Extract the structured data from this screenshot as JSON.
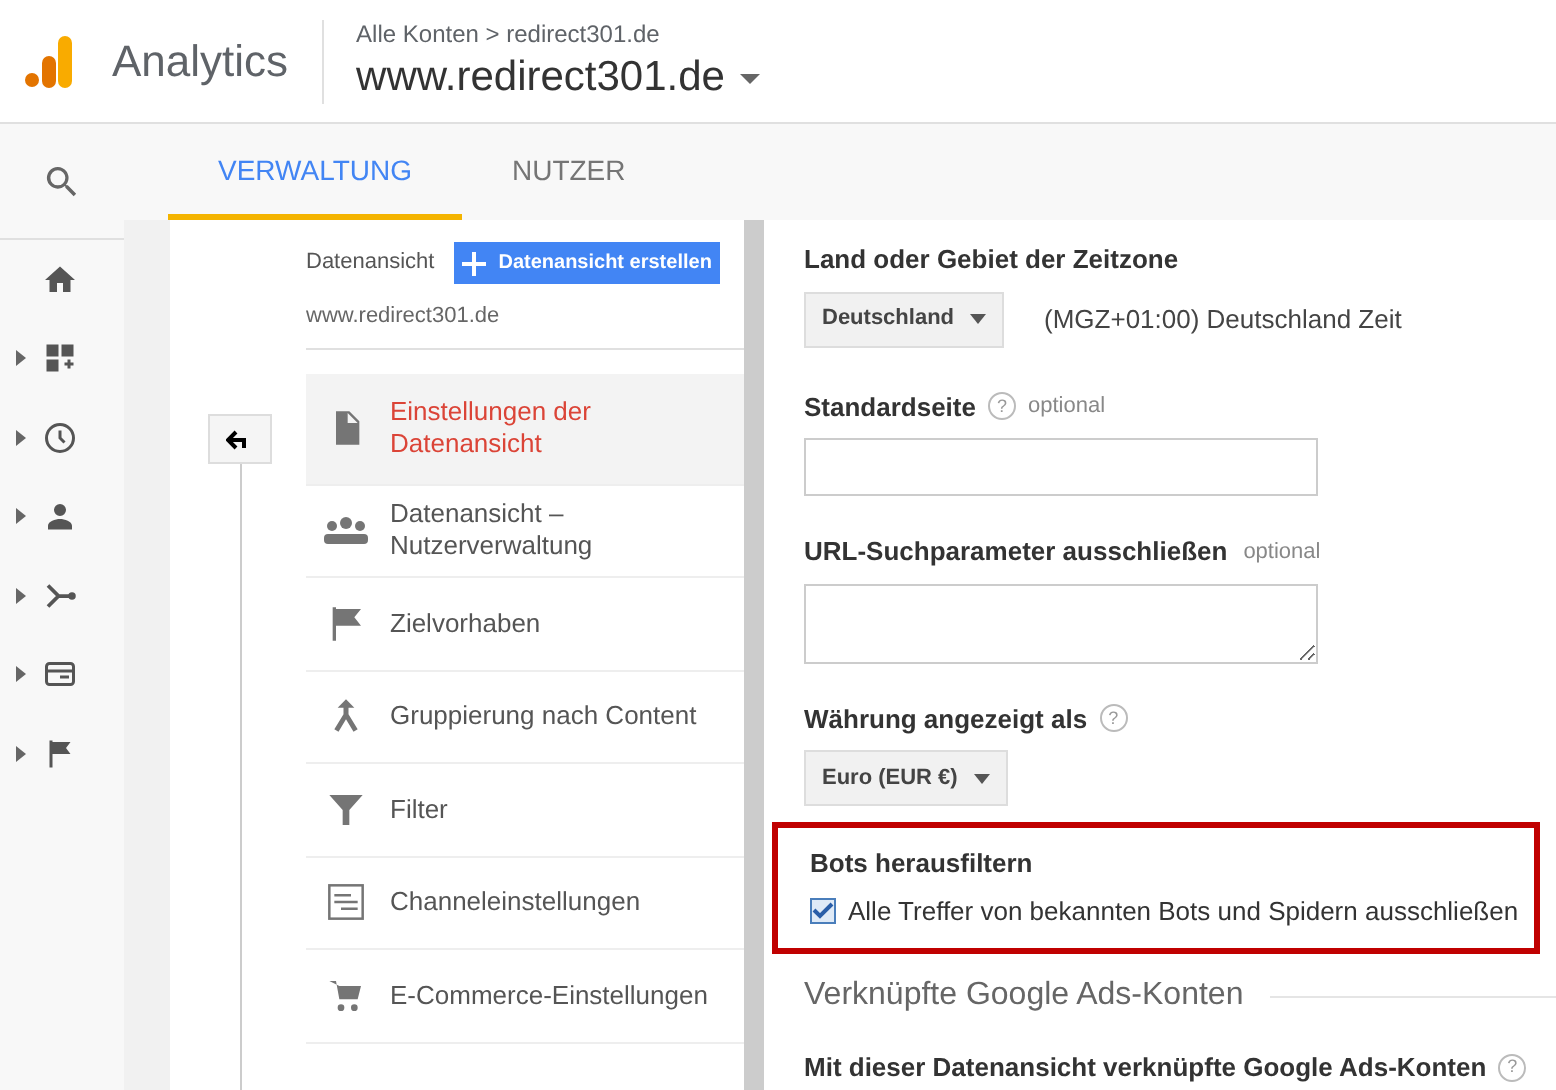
{
  "header": {
    "product": "Analytics",
    "breadcrumb": "Alle Konten > redirect301.de",
    "property": "www.redirect301.de"
  },
  "tabs": [
    {
      "label": "VERWALTUNG",
      "selected": true
    },
    {
      "label": "NUTZER",
      "selected": false
    }
  ],
  "sidebar": {
    "items": [
      {
        "expandable": false
      },
      {
        "expandable": true
      },
      {
        "expandable": true
      },
      {
        "expandable": true
      },
      {
        "expandable": true
      },
      {
        "expandable": true
      },
      {
        "expandable": true
      }
    ]
  },
  "view_column": {
    "label": "Datenansicht",
    "create_button": "Datenansicht erstellen",
    "view_name": "www.redirect301.de",
    "items": [
      {
        "label": "Einstellungen der Datenansicht",
        "selected": true
      },
      {
        "label": "Datenansicht – Nutzerverwaltung",
        "selected": false
      },
      {
        "label": "Zielvorhaben",
        "selected": false
      },
      {
        "label": "Gruppierung nach Content",
        "selected": false
      },
      {
        "label": "Filter",
        "selected": false
      },
      {
        "label": "Channeleinstellungen",
        "selected": false
      },
      {
        "label": "E-Commerce-Einstellungen",
        "selected": false
      }
    ]
  },
  "settings": {
    "timezone": {
      "label": "Land oder Gebiet der Zeitzone",
      "select": "Deutschland",
      "text": "(MGZ+01:00) Deutschland Zeit"
    },
    "default_page": {
      "label": "Standardseite",
      "help": "?",
      "hint": "optional"
    },
    "url_params": {
      "label": "URL-Suchparameter ausschließen",
      "hint": "optional"
    },
    "currency": {
      "label": "Währung angezeigt als",
      "help": "?",
      "select": "Euro (EUR €)"
    },
    "bots": {
      "label": "Bots herausfiltern",
      "checkbox": "Alle Treffer von bekannten Bots und Spidern ausschließen",
      "checked": true
    },
    "ads_section": "Verknüpfte Google Ads-Konten",
    "ads_label": "Mit dieser Datenansicht verknüpfte Google Ads-Konten",
    "ads_help": "?"
  }
}
